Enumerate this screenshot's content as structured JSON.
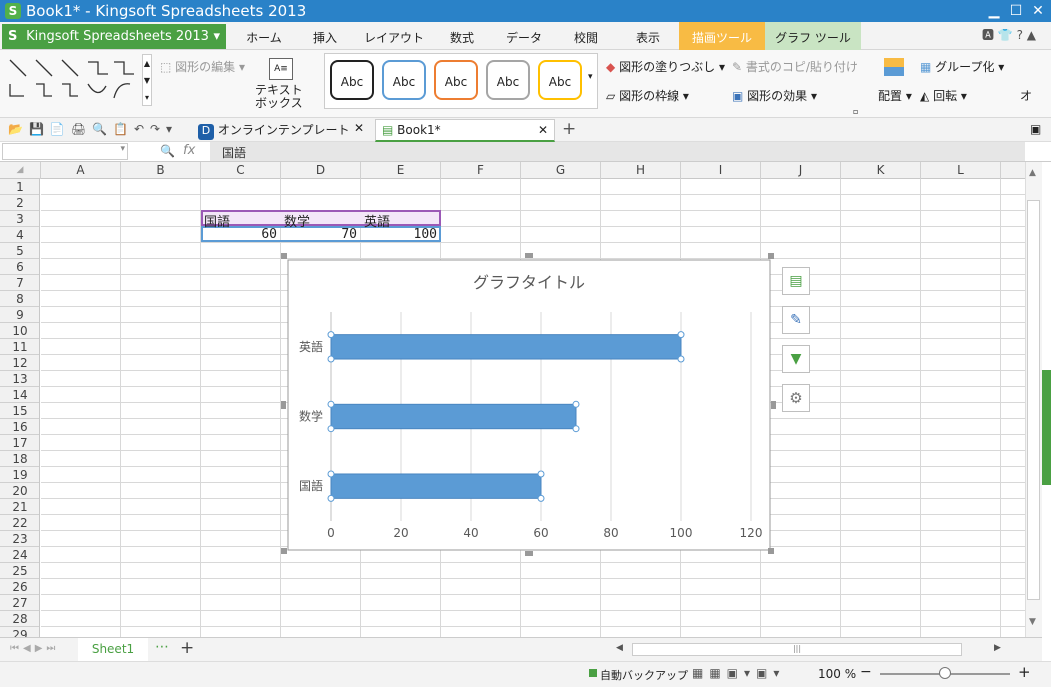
{
  "window": {
    "title": "Book1* - Kingsoft Spreadsheets 2013",
    "app_icon": "S"
  },
  "menu": {
    "app_button": "Kingsoft Spreadsheets 2013",
    "tabs": [
      "ホーム",
      "挿入",
      "レイアウト",
      "数式",
      "データ",
      "校閲",
      "表示",
      "描画ツール",
      "グラフ ツール"
    ]
  },
  "ribbon": {
    "edit_shape": "図形の編集",
    "textbox": "テキスト\nボックス",
    "style_label": "Abc",
    "fill": "図形の塗りつぶし",
    "copy_paste_format": "書式のコピ/貼り付け",
    "outline": "図形の枠線",
    "effect": "図形の効果",
    "arrange": "配置",
    "group": "グループ化",
    "rotate": "回転",
    "more": "オ"
  },
  "doc_tabs": [
    {
      "label": "オンラインテンプレート"
    },
    {
      "label": "Book1*"
    }
  ],
  "formula_bar": {
    "fx": "fx",
    "content": "国語"
  },
  "columns": [
    "A",
    "B",
    "C",
    "D",
    "E",
    "F",
    "G",
    "H",
    "I",
    "J",
    "K",
    "L"
  ],
  "rows": [
    "1",
    "2",
    "3",
    "4",
    "5",
    "6",
    "7",
    "8",
    "9",
    "10",
    "11",
    "12",
    "13",
    "14",
    "15",
    "16",
    "17",
    "18",
    "19",
    "20",
    "21",
    "22",
    "23",
    "24",
    "25",
    "26",
    "27",
    "28",
    "29"
  ],
  "cells": {
    "c3": "国語",
    "d3": "数学",
    "e3": "英語",
    "c4": "60",
    "d4": "70",
    "e4": "100"
  },
  "chart_data": {
    "type": "bar",
    "orientation": "horizontal",
    "title": "グラフタイトル",
    "categories": [
      "国語",
      "数学",
      "英語"
    ],
    "values": [
      60,
      70,
      100
    ],
    "xlim": [
      0,
      120
    ],
    "xticks": [
      0,
      20,
      40,
      60,
      80,
      100,
      120
    ],
    "bar_color": "#5b9bd5",
    "grid": true
  },
  "sheet_tabs": [
    "Sheet1"
  ],
  "status": {
    "backup": "自動バックアップ",
    "zoom": "100 %"
  },
  "colors": {
    "title_blue": "#2a82c8",
    "app_green": "#4aa043",
    "draw_tool_orange": "#f8bb44",
    "chart_tool_green": "#c9e4c3"
  }
}
